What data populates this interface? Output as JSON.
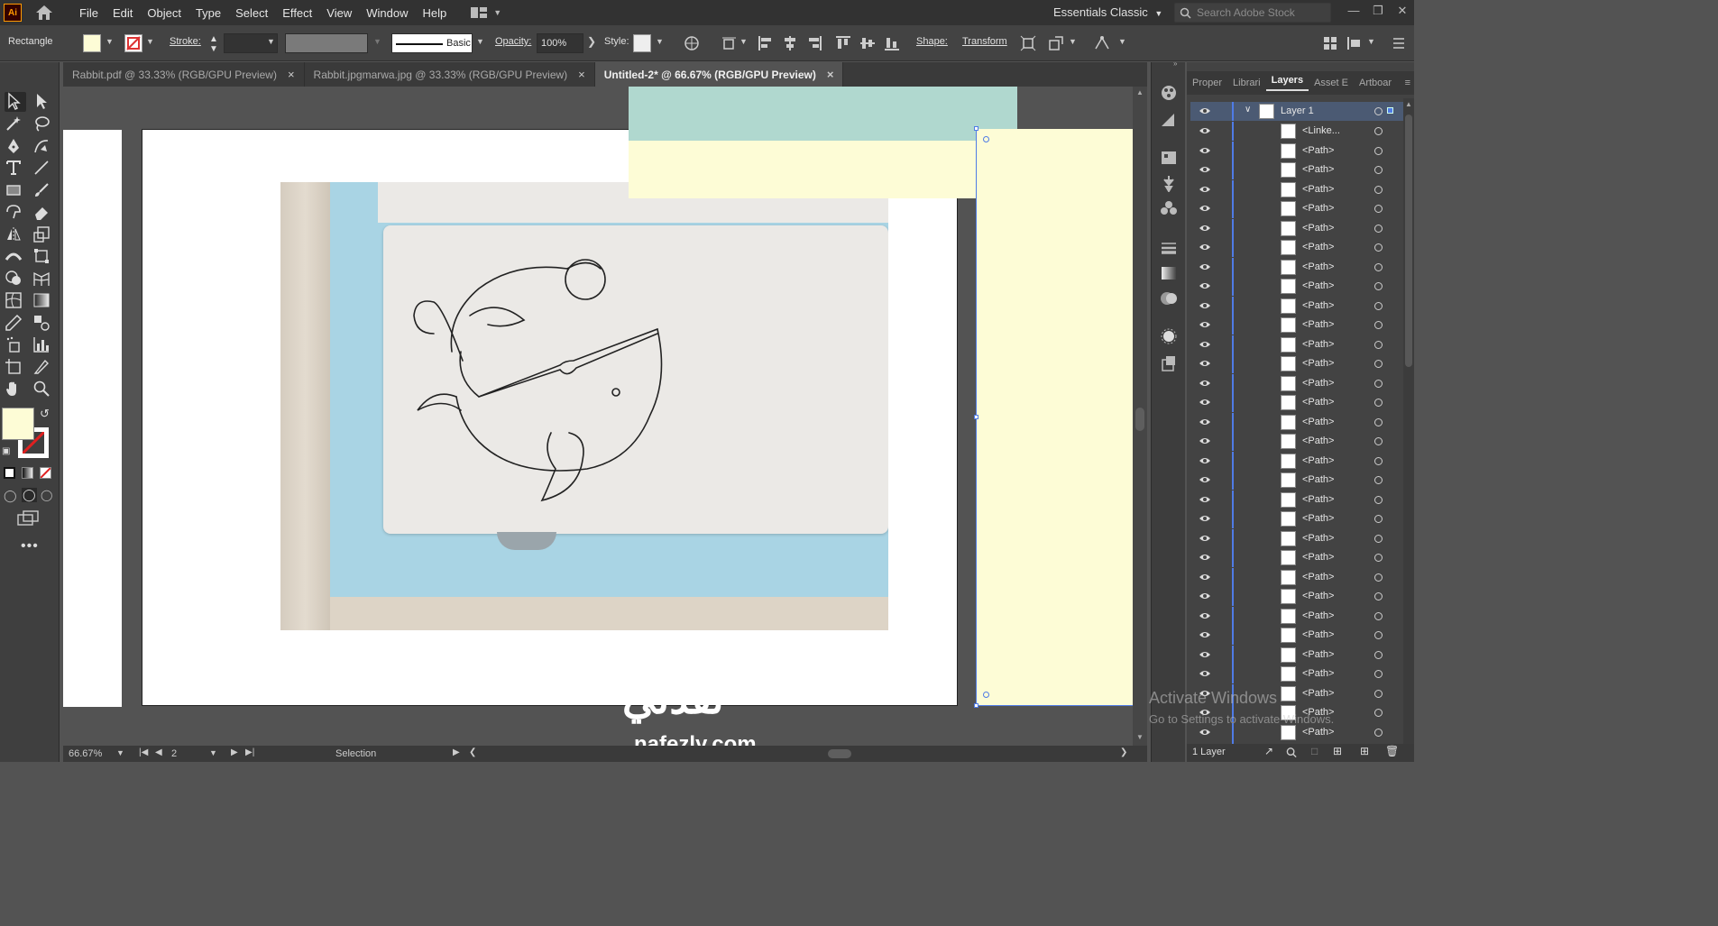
{
  "app": {
    "logo": "Ai",
    "menu": [
      "File",
      "Edit",
      "Object",
      "Type",
      "Select",
      "Effect",
      "View",
      "Window",
      "Help"
    ],
    "workspace": "Essentials Classic",
    "search_placeholder": "Search Adobe Stock"
  },
  "control": {
    "tool_name": "Rectangle",
    "stroke_label": "Stroke:",
    "brush_label": "Basic",
    "opacity_label": "Opacity:",
    "opacity_value": "100%",
    "style_label": "Style:",
    "shape_label": "Shape:",
    "transform_label": "Transform",
    "fill_color": "#fdfcd6"
  },
  "tabs": [
    {
      "label": "Rabbit.pdf @ 33.33% (RGB/GPU Preview)",
      "close": "×"
    },
    {
      "label": "Rabbit.jpgmarwa.jpg @ 33.33% (RGB/GPU Preview)",
      "close": "×"
    },
    {
      "label": "Untitled-2* @ 66.67% (RGB/GPU Preview)",
      "close": "×"
    }
  ],
  "status": {
    "zoom": "66.67%",
    "artboard_num": "2",
    "mode": "Selection"
  },
  "panel": {
    "tabs": [
      "Proper",
      "Librari",
      "Layers",
      "Asset E",
      "Artboar"
    ],
    "layer_name": "Layer 1",
    "items": [
      "<Linke...",
      "<Path>",
      "<Path>",
      "<Path>",
      "<Path>",
      "<Path>",
      "<Path>",
      "<Path>",
      "<Path>",
      "<Path>",
      "<Path>",
      "<Path>",
      "<Path>",
      "<Path>",
      "<Path>",
      "<Path>",
      "<Path>",
      "<Path>",
      "<Path>",
      "<Path>",
      "<Path>",
      "<Path>",
      "<Path>",
      "<Path>",
      "<Path>",
      "<Path>",
      "<Path>",
      "<Path>",
      "<Path>",
      "<Path>",
      "<Path>",
      "<Path>",
      "<Path>"
    ],
    "footer": "1 Layer"
  },
  "watermark": {
    "line1": "Activate Windows",
    "line2": "Go to Settings to activate Windows.",
    "brand_ar": "نفذلي",
    "brand_en": "nafezly.com"
  },
  "colors": {
    "fill_yellow": "#fdfcd6",
    "teal": "#b0d8cf",
    "selection_blue": "#4f7be6"
  }
}
